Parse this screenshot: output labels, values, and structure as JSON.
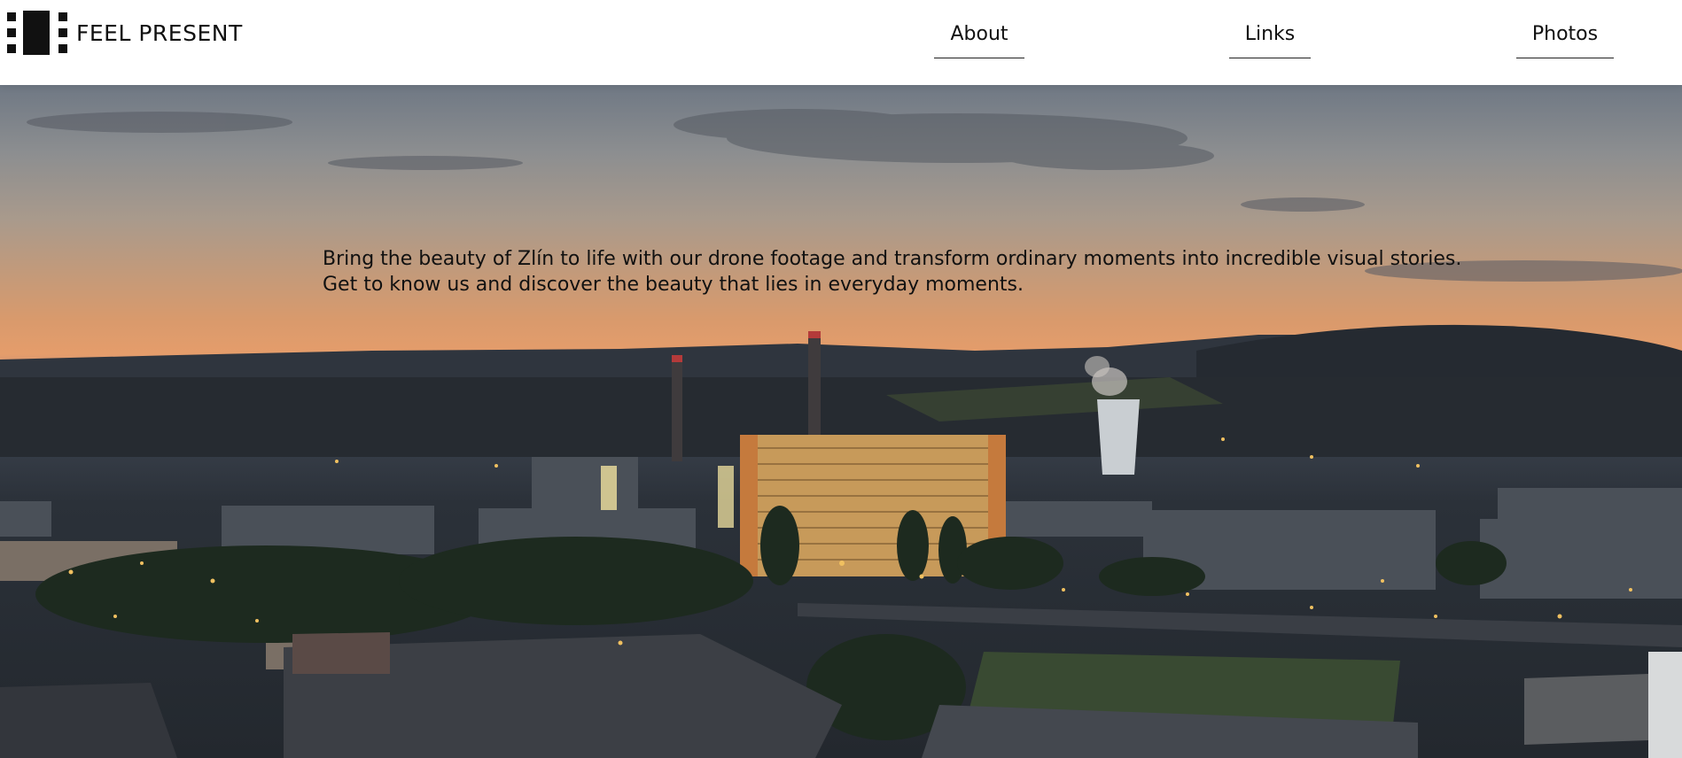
{
  "brand": {
    "name": "FEEL PRESENT",
    "logo_icon": "feel-present-logo-mark"
  },
  "nav": {
    "items": [
      {
        "label": "About"
      },
      {
        "label": "Links"
      },
      {
        "label": "Photos"
      }
    ]
  },
  "hero": {
    "text": "Bring the beauty of Zlín to life with our drone footage and transform ordinary moments into incredible visual stories. Get to know us and discover the beauty that lies in everyday moments.",
    "image_subject": "aerial-dusk-city-photo"
  },
  "colors": {
    "header_bg": "#ffffff",
    "text": "#111111",
    "sky_orange": "#e59d6b"
  }
}
